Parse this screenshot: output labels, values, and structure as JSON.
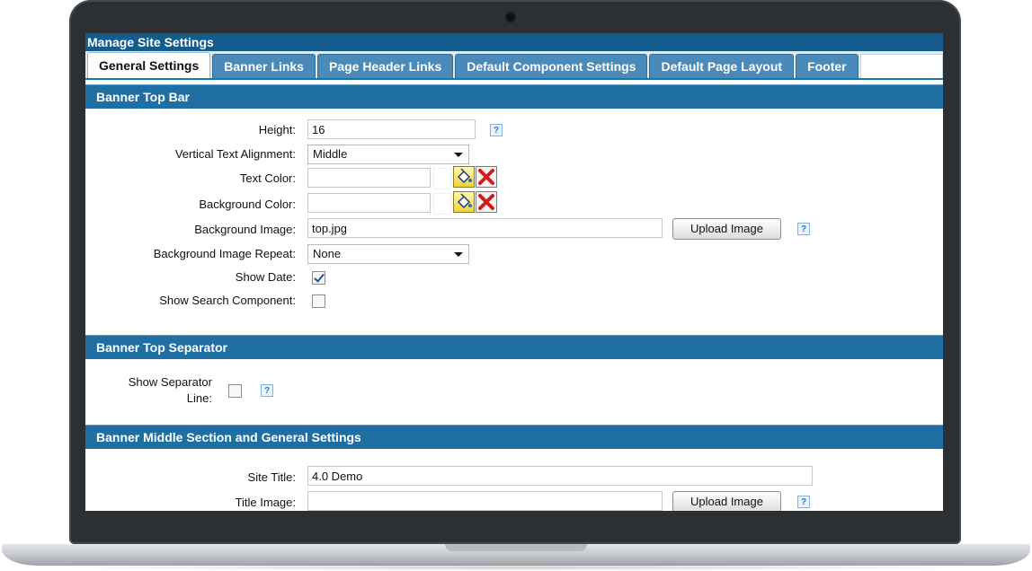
{
  "window": {
    "title": "Manage Site Settings"
  },
  "tabs": [
    {
      "label": "General Settings",
      "active": true
    },
    {
      "label": "Banner Links",
      "active": false
    },
    {
      "label": "Page Header Links",
      "active": false
    },
    {
      "label": "Default Component Settings",
      "active": false
    },
    {
      "label": "Default Page Layout",
      "active": false
    },
    {
      "label": "Footer",
      "active": false
    }
  ],
  "sections": {
    "top_bar": {
      "title": "Banner Top Bar",
      "height": {
        "label": "Height:",
        "value": "16"
      },
      "vertical_alignment": {
        "label": "Vertical Text Alignment:",
        "value": "Middle"
      },
      "text_color": {
        "label": "Text Color:",
        "value": ""
      },
      "background_color": {
        "label": "Background Color:",
        "value": ""
      },
      "background_image": {
        "label": "Background Image:",
        "value": "top.jpg",
        "button": "Upload Image"
      },
      "background_repeat": {
        "label": "Background Image Repeat:",
        "value": "None"
      },
      "show_date": {
        "label": "Show Date:",
        "checked": true
      },
      "show_search": {
        "label": "Show Search Component:",
        "checked": false
      }
    },
    "separator": {
      "title": "Banner Top Separator",
      "show_line": {
        "label_line1": "Show Separator",
        "label_line2": "Line:",
        "checked": false
      }
    },
    "middle": {
      "title": "Banner Middle Section and General Settings",
      "site_title": {
        "label": "Site Title:",
        "value": "4.0 Demo"
      },
      "title_image": {
        "label": "Title Image:",
        "value": "",
        "button": "Upload Image"
      }
    }
  },
  "help_glyph": "?",
  "colors": {
    "header": "#1f6fa3",
    "title_bar": "#135c8c",
    "tab": "#4a8ab8"
  }
}
